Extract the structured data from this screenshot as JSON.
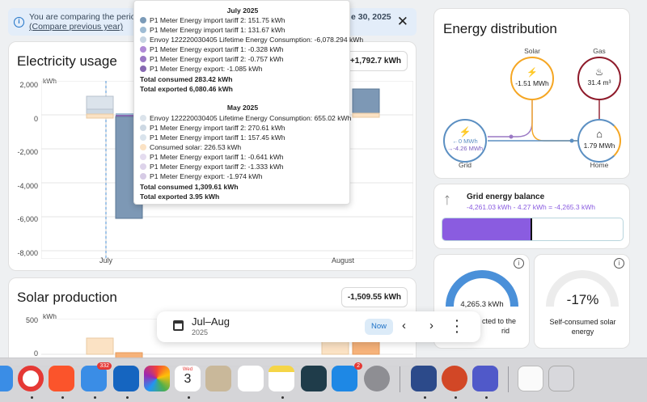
{
  "banner": {
    "text": "You are comparing the period J",
    "text_end": "e 30, 2025",
    "link": "(Compare previous year)"
  },
  "electricity": {
    "title": "Electricity usage",
    "badge": "+1,792.7 kWh",
    "unit": "kWh",
    "y_ticks": [
      "2,000",
      "0",
      "-2,000",
      "-4,000",
      "-6,000",
      "-8,000"
    ],
    "x_ticks": [
      "July",
      "August"
    ]
  },
  "tooltip": {
    "section1_title": "July 2025",
    "section1_rows": [
      {
        "label": "P1 Meter Energy import tariff 2: 151.75 kWh",
        "color": "#7b9bb8"
      },
      {
        "label": "P1 Meter Energy import tariff 1: 131.67 kWh",
        "color": "#9fbcd4"
      },
      {
        "label": "Envoy 122220030405 Lifetime Energy Consumption: -6,078.294 kWh",
        "color": "#c6d4e2"
      },
      {
        "label": "P1 Meter Energy export tariff 1: -0.328 kWh",
        "color": "#b08ad6"
      },
      {
        "label": "P1 Meter Energy export tariff 2: -0.757 kWh",
        "color": "#9a78c4"
      },
      {
        "label": "P1 Meter Energy export: -1.085 kWh",
        "color": "#8669b0"
      }
    ],
    "section1_total_consumed": "Total consumed 283.42 kWh",
    "section1_total_exported": "Total exported 6,080.46 kWh",
    "section2_title": "May 2025",
    "section2_rows": [
      {
        "label": "Envoy 122220030405 Lifetime Energy Consumption: 655.02 kWh",
        "color": "#dbe3eb"
      },
      {
        "label": "P1 Meter Energy import tariff 2: 270.61 kWh",
        "color": "#cdd8e3"
      },
      {
        "label": "P1 Meter Energy import tariff 1: 157.45 kWh",
        "color": "#d9e3ec"
      },
      {
        "label": "Consumed solar: 226.53 kWh",
        "color": "#fbe2c4"
      },
      {
        "label": "P1 Meter Energy export tariff 1: -0.641 kWh",
        "color": "#e4dcef"
      },
      {
        "label": "P1 Meter Energy export tariff 2: -1.333 kWh",
        "color": "#ddd3ea"
      },
      {
        "label": "P1 Meter Energy export: -1.974 kWh",
        "color": "#d6cbe5"
      }
    ],
    "section2_total_consumed": "Total consumed 1,309.61 kWh",
    "section2_total_exported": "Total exported 3.95 kWh"
  },
  "solar": {
    "title": "Solar production",
    "badge": "-1,509.55 kWh",
    "unit": "kWh",
    "y_ticks": [
      "500",
      "0"
    ]
  },
  "energy_distribution": {
    "title": "Energy distribution",
    "solar_label": "Solar",
    "solar_value": "-1.51 MWh",
    "gas_label": "Gas",
    "gas_value": "31.4 m³",
    "grid_label": "Grid",
    "grid_in": "←0 MWh",
    "grid_out": "→-4.26 MWh",
    "home_label": "Home",
    "home_value": "1.79 MWh"
  },
  "grid_balance": {
    "title": "Grid energy balance",
    "formula": "-4,261.03 kWh - 4.27 kWh = -4,265.3 kWh",
    "fill_fraction": 0.49
  },
  "gauge_left": {
    "value": "4,265.3 kWh",
    "label_line1": "cted to the",
    "label_line2": "rid"
  },
  "gauge_right": {
    "value": "-17%",
    "label": "Self-consumed solar energy"
  },
  "toolbar": {
    "period": "Jul–Aug",
    "year": "2025",
    "now": "Now"
  },
  "dock": {
    "mail_badge": "332",
    "cal_month": "Wed",
    "cal_day": "3",
    "appstore_badge": "2"
  },
  "colors": {
    "accent": "#1e72c7",
    "grid_bar": "#8a5ce0",
    "solar_ring": "#f5a623",
    "gas_ring": "#8e1a2a",
    "grid_ring": "#5b8fc2",
    "home_ring": "#5b8fc2"
  }
}
